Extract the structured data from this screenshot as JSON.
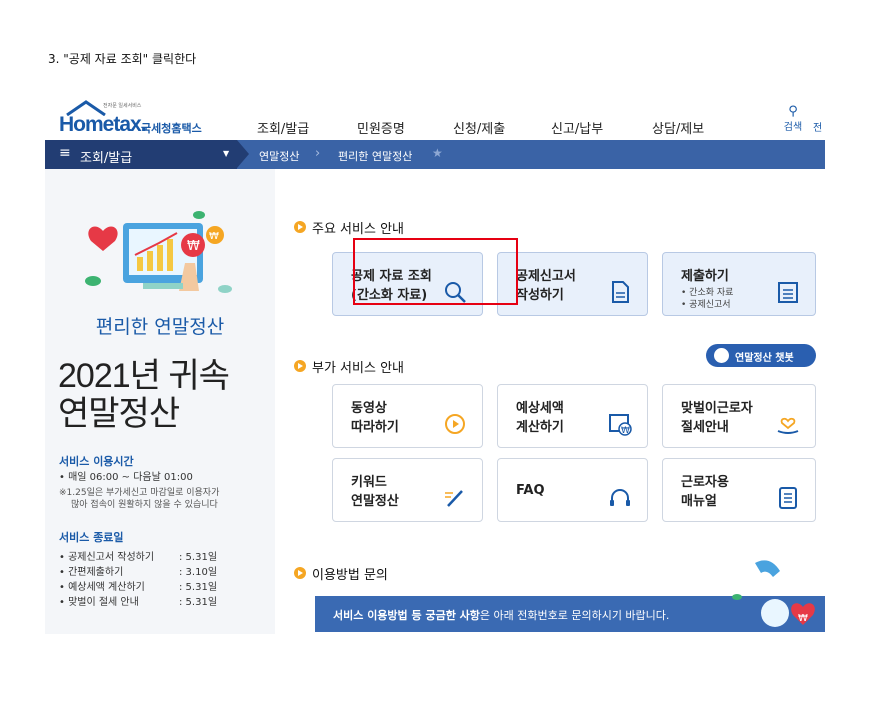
{
  "caption": "3. \"공제 자료 조회\" 클릭한다",
  "header": {
    "logo_small": "전자문 일세서비스",
    "logo_main": "Hometax.",
    "logo_sub": "국세청홈택스",
    "menu": [
      "조회/발급",
      "민원증명",
      "신청/제출",
      "신고/납부",
      "상담/제보"
    ],
    "search_label": "검색",
    "cut_label": "전"
  },
  "nav": {
    "menu_label": "조회/발급",
    "crumbs": [
      "연말정산",
      "편리한 연말정산"
    ]
  },
  "left": {
    "title": "편리한 연말정산",
    "year_line1": "2021년 귀속",
    "year_line2": "연말정산",
    "hours_title": "서비스 이용시간",
    "hours_line": "• 매일 06:00 ~ 다음날 01:00",
    "hours_note1": "※1.25일은 부가세신고 마감일로 이용자가",
    "hours_note2": "많아 접속이 원활하지 않을 수 있습니다",
    "end_title": "서비스 종료일",
    "end_rows": [
      {
        "k": "• 공제신고서 작성하기",
        "v": ": 5.31일"
      },
      {
        "k": "• 간편제출하기",
        "v": ": 3.10일"
      },
      {
        "k": "• 예상세액 계산하기",
        "v": ": 5.31일"
      },
      {
        "k": "• 맞벌이 절세 안내",
        "v": ": 5.31일"
      }
    ]
  },
  "main": {
    "section1": "주요 서비스 안내",
    "card1_l1": "공제 자료 조회",
    "card1_l2": "(간소화 자료)",
    "card2_l1": "공제신고서",
    "card2_l2": "작성하기",
    "card3_title": "제출하기",
    "card3_sub1": "• 간소화 자료",
    "card3_sub2": "• 공제신고서",
    "section2": "부가 서비스 안내",
    "chatbot": "연말정산 챗봇",
    "card4_l1": "동영상",
    "card4_l2": "따라하기",
    "card5_l1": "예상세액",
    "card5_l2": "계산하기",
    "card6_l1": "맞벌이근로자",
    "card6_l2": "절세안내",
    "card7_l1": "키워드",
    "card7_l2": "연말정산",
    "card8_l1": "FAQ",
    "card9_l1": "근로자용",
    "card9_l2": "매뉴얼",
    "section3": "이용방법 문의",
    "banner_bold": "서비스 이용방법 등 궁금한 사항",
    "banner_rest": "은 아래 전화번호로 문의하시기 바랍니다."
  },
  "colors": {
    "brand": "#1a5aa8",
    "nav_dark": "#223d73",
    "nav": "#3a63a6",
    "highlight": "#e60012",
    "accent": "#f5a623"
  }
}
